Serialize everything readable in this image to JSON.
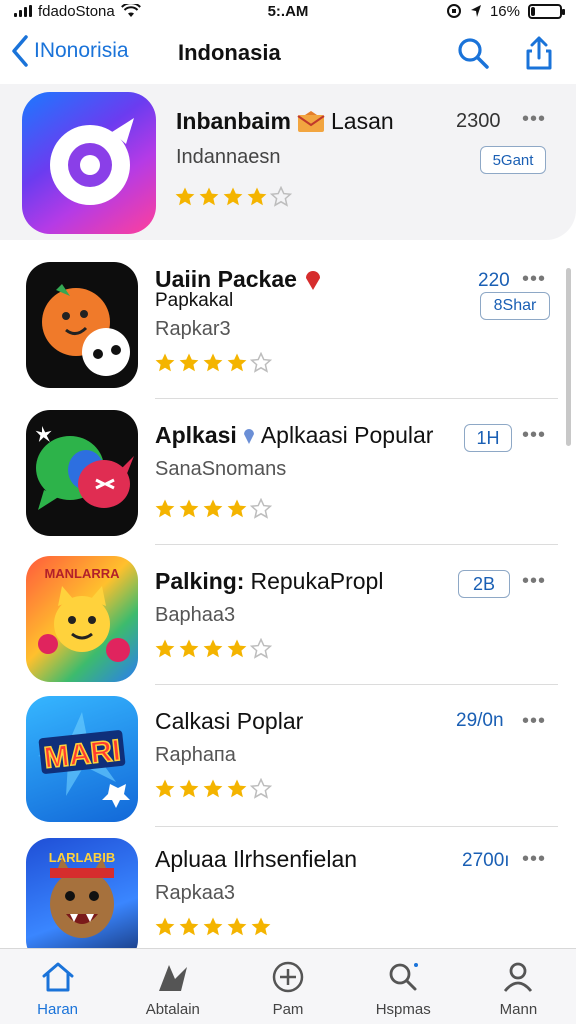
{
  "status_bar": {
    "carrier": "fdadoStona",
    "time": "5:.AM",
    "battery": "16%",
    "battery_level": 0.16
  },
  "nav": {
    "back_label": "INonorisia",
    "title": "Indonasia",
    "search_icon": "search-icon",
    "share_icon": "share-icon"
  },
  "featured": {
    "name": "Inbanbaim",
    "name_extra": "Lasan",
    "subtitle": "Indannaesn",
    "count": "2300",
    "button_label": "5Gant",
    "rating": 4,
    "icon_colors": [
      "#1b79ff",
      "#6b3cf0",
      "#b43be6",
      "#ff3f9a"
    ]
  },
  "apps": [
    {
      "name": "Uaiin Packae",
      "name2": "Papkakal",
      "subtitle": "Rapkar3",
      "count": "220",
      "button_label": "8Shar",
      "rating": 4
    },
    {
      "name": "Aplkasi",
      "name_extra": "Aplkaasi Popular",
      "subtitle": "SanaSnomans",
      "button_label": "1H",
      "rating": 4
    },
    {
      "name": "Palking:",
      "name_extra": "RepukaPropl",
      "subtitle": "Baphaa3",
      "button_label": "2B",
      "rating": 4
    },
    {
      "name": "Calkasi Poplar",
      "subtitle": "Raphaпa",
      "count": "29/0n",
      "icon_text": "MARI",
      "rating": 4
    },
    {
      "name": "Apluaa Ilrhsenfielan",
      "subtitle": "Rapkaa3",
      "count": "2700ı",
      "icon_text": "LARLABIB",
      "rating": 5
    }
  ],
  "tabs": [
    {
      "label": "Haran",
      "icon": "home-icon",
      "active": true
    },
    {
      "label": "Abtalain",
      "icon": "apps-icon",
      "active": false
    },
    {
      "label": "Pam",
      "icon": "plus-circle-icon",
      "active": false
    },
    {
      "label": "Hspmas",
      "icon": "search-icon",
      "active": false
    },
    {
      "label": "Mann",
      "icon": "person-icon",
      "active": false
    }
  ],
  "colors": {
    "accent": "#1a73d9",
    "star": "#f4b400",
    "star_empty": "#bdbdbd"
  }
}
